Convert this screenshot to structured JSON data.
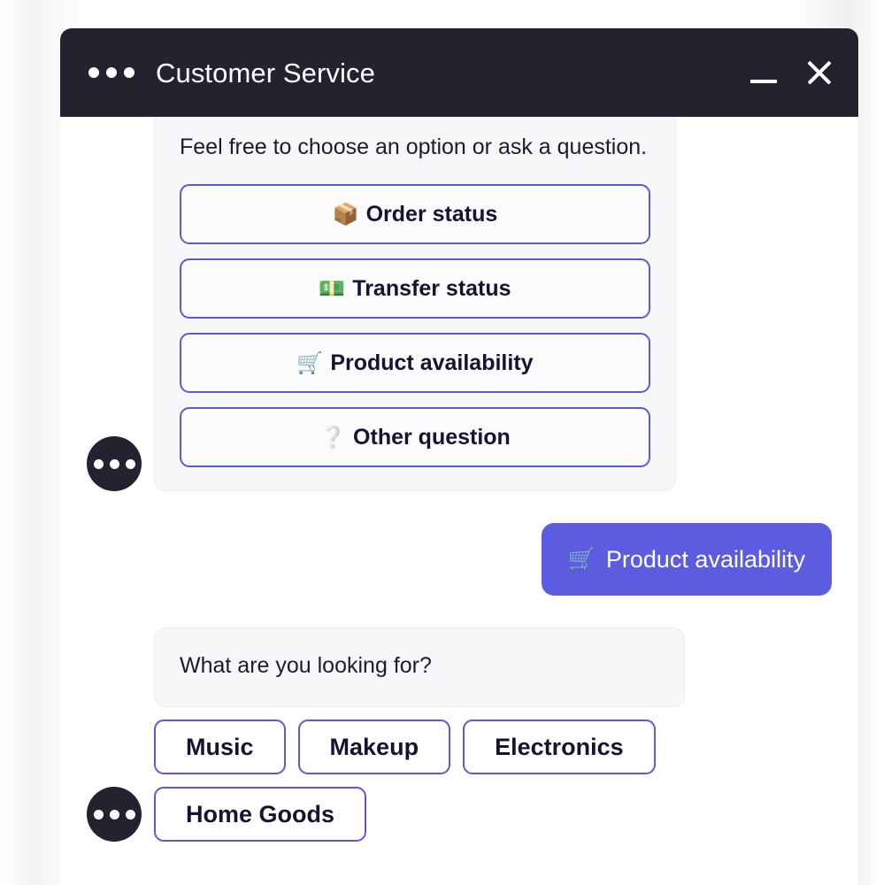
{
  "window": {
    "title": "Customer Service",
    "header_bg": "#22232e",
    "accent": "#5b5bd6",
    "user_bubble_bg": "#5c5ce0",
    "bot_bubble_bg": "#f6f7f9",
    "menu_icon": "three-dots-icon",
    "minimize_label": "—",
    "close_label": "✕"
  },
  "conversation": {
    "bot_intro": {
      "avatar_icon": "three-dots-avatar",
      "text": "Feel free to choose an option or ask a question.",
      "options": [
        {
          "emoji": "📦",
          "emoji_name": "package-icon",
          "label": "Order status"
        },
        {
          "emoji": "💵",
          "emoji_name": "banknote-icon",
          "label": "Transfer status"
        },
        {
          "emoji": "🛒",
          "emoji_name": "shopping-cart-icon",
          "label": "Product availability"
        },
        {
          "emoji": "❔",
          "emoji_name": "question-mark-icon",
          "label": "Other question"
        }
      ]
    },
    "user_reply": {
      "emoji": "🛒",
      "emoji_name": "shopping-cart-icon",
      "label": "Product availability"
    },
    "bot_followup": {
      "avatar_icon": "three-dots-avatar",
      "text": "What are you looking for?",
      "quick_replies": [
        {
          "label": "Music"
        },
        {
          "label": "Makeup"
        },
        {
          "label": "Electronics"
        },
        {
          "label": "Home Goods"
        }
      ]
    }
  }
}
